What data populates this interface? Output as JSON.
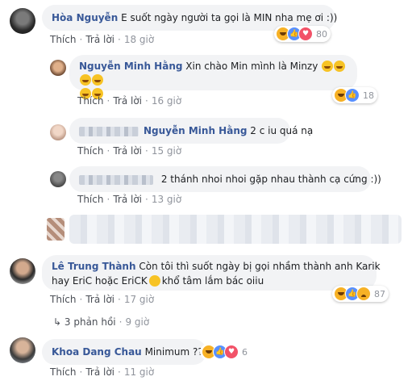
{
  "comments": [
    {
      "author": "Hòa Nguyễn",
      "text": "E suốt ngày người ta gọi là MIN nha mẹ ơi :))",
      "actions": {
        "like": "Thích",
        "reply": "Trả lời",
        "time": "18 giờ"
      },
      "reactions": {
        "types": [
          "haha",
          "like",
          "love"
        ],
        "count": "80"
      }
    },
    {
      "author": "Nguyễn Minh Hằng",
      "text": "Xin chào Min mình là Minzy",
      "actions": {
        "like": "Thích",
        "reply": "Trả lời",
        "time": "16 giờ"
      },
      "reactions": {
        "types": [
          "haha",
          "like"
        ],
        "count": "18"
      }
    },
    {
      "author": "Nguyễn Minh Hằng",
      "text": "2 c iu quá nạ",
      "actions": {
        "like": "Thích",
        "reply": "Trả lời",
        "time": "15 giờ"
      }
    },
    {
      "text": "2 thánh nhoi nhoi gặp nhau thành cạ cứng :))",
      "actions": {
        "like": "Thích",
        "reply": "Trả lời",
        "time": "13 giờ"
      }
    },
    {
      "author": "Lê Trung Thành",
      "text_line1": "Còn tôi thì suốt ngày bị gọi nhầm thành anh Karik",
      "text_line2_a": "hay EriC hoặc EriCK",
      "text_line2_b": "khổ tâm lắm bác oiiu",
      "actions": {
        "like": "Thích",
        "reply": "Trả lời",
        "time": "17 giờ"
      },
      "reactions": {
        "types": [
          "haha",
          "like",
          "sad"
        ],
        "count": "87"
      },
      "replies": {
        "label": "3 phản hồi",
        "time": "9 giờ"
      }
    },
    {
      "author": "Khoa Dang Chau",
      "text": "Minimum ???",
      "actions": {
        "like": "Thích",
        "reply": "Trả lời",
        "time": "11 giờ"
      },
      "reactions": {
        "types": [
          "haha",
          "like",
          "love"
        ],
        "count": "6"
      }
    }
  ],
  "colors": {
    "name": "#385898",
    "bubble": "#f2f3f5",
    "meta": "#90949c",
    "like": "#5890ff",
    "love": "#f25268",
    "haha": "#f7b125"
  }
}
